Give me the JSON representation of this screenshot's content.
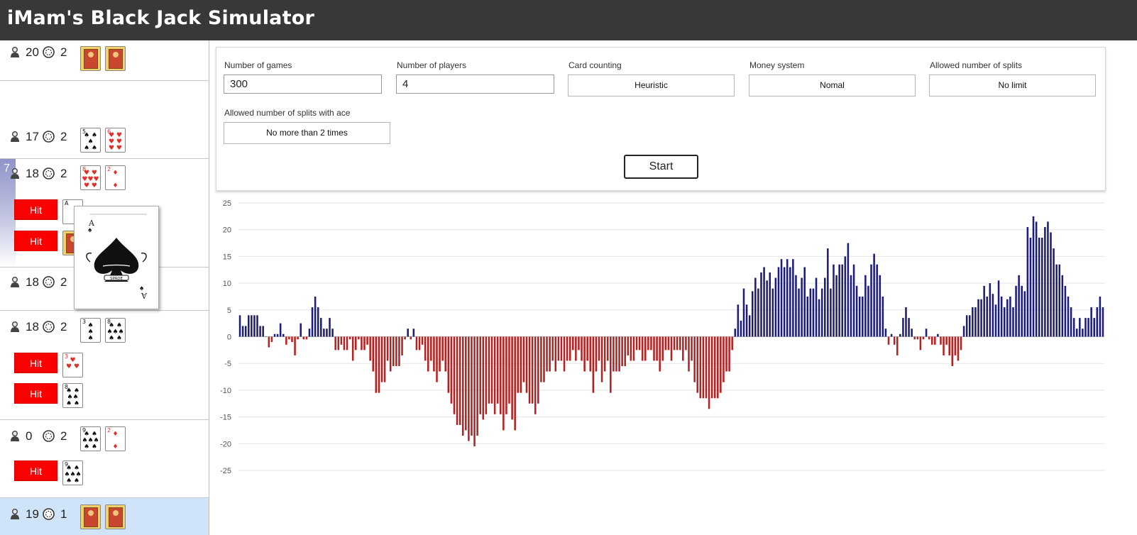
{
  "app": {
    "title": "iMam's Black Jack Simulator"
  },
  "sidebar": {
    "hit_label": "Hit",
    "active_badge": "7",
    "rows": [
      {
        "score": "20",
        "chips": "2"
      },
      {
        "score": "17",
        "chips": "2"
      },
      {
        "score": "18",
        "chips": "2"
      },
      {
        "score": "18",
        "chips": "2"
      },
      {
        "score": "18",
        "chips": "2"
      },
      {
        "score": "0",
        "chips": "2"
      },
      {
        "score": "19",
        "chips": "1"
      }
    ],
    "popup_card": {
      "rank": "A",
      "suit": "spades",
      "text": "SPADE"
    }
  },
  "settings": {
    "games": {
      "label": "Number of games",
      "value": "300"
    },
    "players": {
      "label": "Number of players",
      "value": "4"
    },
    "counting": {
      "label": "Card counting",
      "value": "Heuristic"
    },
    "money": {
      "label": "Money system",
      "value": "Nomal"
    },
    "splits": {
      "label": "Allowed number of splits",
      "value": "No limit"
    },
    "splits_ace": {
      "label": "Allowed number of splits with ace",
      "value": "No more than 2 times"
    },
    "start_label": "Start"
  },
  "chart_data": {
    "type": "bar",
    "ylim": [
      -25,
      25
    ],
    "yticks": [
      "25",
      "20",
      "15",
      "10",
      "5",
      "0",
      "-5",
      "-10",
      "-15",
      "-20",
      "-25"
    ],
    "grid": true,
    "positive_color": "#1c1c7c",
    "negative_color": "#b22222",
    "x": [
      1,
      2,
      3,
      4,
      5,
      6,
      7,
      8,
      9,
      10,
      11,
      12,
      13,
      14,
      15,
      16,
      17,
      18,
      19,
      20,
      21,
      22,
      23,
      24,
      25,
      26,
      27,
      28,
      29,
      30,
      31,
      32,
      33,
      34,
      35,
      36,
      37,
      38,
      39,
      40,
      41,
      42,
      43,
      44,
      45,
      46,
      47,
      48,
      49,
      50,
      51,
      52,
      53,
      54,
      55,
      56,
      57,
      58,
      59,
      60,
      61,
      62,
      63,
      64,
      65,
      66,
      67,
      68,
      69,
      70,
      71,
      72,
      73,
      74,
      75,
      76,
      77,
      78,
      79,
      80,
      81,
      82,
      83,
      84,
      85,
      86,
      87,
      88,
      89,
      90,
      91,
      92,
      93,
      94,
      95,
      96,
      97,
      98,
      99,
      100,
      101,
      102,
      103,
      104,
      105,
      106,
      107,
      108,
      109,
      110,
      111,
      112,
      113,
      114,
      115,
      116,
      117,
      118,
      119,
      120,
      121,
      122,
      123,
      124,
      125,
      126,
      127,
      128,
      129,
      130,
      131,
      132,
      133,
      134,
      135,
      136,
      137,
      138,
      139,
      140,
      141,
      142,
      143,
      144,
      145,
      146,
      147,
      148,
      149,
      150,
      151,
      152,
      153,
      154,
      155,
      156,
      157,
      158,
      159,
      160,
      161,
      162,
      163,
      164,
      165,
      166,
      167,
      168,
      169,
      170,
      171,
      172,
      173,
      174,
      175,
      176,
      177,
      178,
      179,
      180,
      181,
      182,
      183,
      184,
      185,
      186,
      187,
      188,
      189,
      190,
      191,
      192,
      193,
      194,
      195,
      196,
      197,
      198,
      199,
      200,
      201,
      202,
      203,
      204,
      205,
      206,
      207,
      208,
      209,
      210,
      211,
      212,
      213,
      214,
      215,
      216,
      217,
      218,
      219,
      220,
      221,
      222,
      223,
      224,
      225,
      226,
      227,
      228,
      229,
      230,
      231,
      232,
      233,
      234,
      235,
      236,
      237,
      238,
      239,
      240,
      241,
      242,
      243,
      244,
      245,
      246,
      247,
      248,
      249,
      250,
      251,
      252,
      253,
      254,
      255,
      256,
      257,
      258,
      259,
      260,
      261,
      262,
      263,
      264,
      265,
      266,
      267,
      268,
      269,
      270,
      271,
      272,
      273,
      274,
      275,
      276,
      277,
      278,
      279,
      280,
      281,
      282,
      283,
      284,
      285,
      286,
      287,
      288,
      289,
      290,
      291,
      292,
      293,
      294,
      295,
      296,
      297,
      298,
      299,
      300
    ],
    "values": [
      4,
      2,
      2,
      4,
      4,
      4,
      4,
      2,
      2,
      0,
      -2,
      -1,
      0.5,
      0.5,
      2.5,
      0.5,
      -1.5,
      -0.5,
      -1,
      -3.5,
      -0.5,
      2.5,
      -0.5,
      -0.5,
      1.5,
      5.5,
      7.5,
      5.5,
      3.5,
      1.5,
      1.5,
      3.5,
      1.5,
      -2.5,
      -2.5,
      -1.5,
      -2.5,
      -2.5,
      -0.5,
      -4.5,
      -2.5,
      -0.5,
      -2.5,
      -2.5,
      -1.5,
      -4.5,
      -6.5,
      -10.5,
      -10.5,
      -8.5,
      -8.5,
      -4.5,
      -6.5,
      -5.5,
      -5.5,
      -5.5,
      -3.5,
      -0.5,
      1.5,
      -0.5,
      1.5,
      -2.5,
      -2.5,
      -1.5,
      -4.5,
      -6.5,
      -4.5,
      -6.5,
      -8.5,
      -6.5,
      -4.5,
      -6.5,
      -10.5,
      -12.5,
      -14.5,
      -16.5,
      -16.5,
      -18.5,
      -17.5,
      -19.5,
      -18.5,
      -20.5,
      -18.5,
      -14.5,
      -15.5,
      -14.5,
      -12.5,
      -12.5,
      -14.5,
      -12.5,
      -14.5,
      -17.5,
      -14.5,
      -12.5,
      -15.5,
      -17.5,
      -10.5,
      -10.5,
      -8.5,
      -10.5,
      -12.5,
      -12.5,
      -14.5,
      -12.5,
      -8.5,
      -8.5,
      -6.5,
      -6.5,
      -4.5,
      -6.5,
      -4.5,
      -4.5,
      -6.5,
      -4.5,
      -4.5,
      -2.5,
      -4.5,
      -2.5,
      -4.5,
      -6.5,
      -4.5,
      -6.5,
      -10.5,
      -6.5,
      -4.5,
      -8.5,
      -6.5,
      -4.5,
      -10.5,
      -6.5,
      -6.5,
      -6.5,
      -5.5,
      -5.5,
      -3.5,
      -4.5,
      -4.5,
      -2.5,
      -2.5,
      -4.5,
      -4.5,
      -2.5,
      -2.5,
      -4.5,
      -4.5,
      -6.5,
      -4.5,
      -2.5,
      -2.5,
      -4.5,
      -2.5,
      -2.5,
      -2.5,
      -4.5,
      -2.5,
      -6.5,
      -4.5,
      -8.5,
      -10.5,
      -11.5,
      -11.5,
      -11.5,
      -13.5,
      -11.5,
      -11.5,
      -11.5,
      -10.5,
      -8.5,
      -6.5,
      -6.5,
      -2.5,
      1.5,
      6,
      3,
      9,
      6,
      4,
      8.5,
      11,
      9,
      12,
      13,
      10.5,
      12,
      9,
      11,
      13,
      14.5,
      13,
      14.5,
      13,
      14.5,
      11.5,
      9,
      11,
      13,
      7.5,
      9,
      9,
      11,
      7,
      9,
      11,
      16.5,
      9,
      13.5,
      11.5,
      13.5,
      13.5,
      15,
      17.5,
      11.5,
      13.5,
      9.5,
      7.5,
      7.5,
      11.5,
      9.5,
      13.5,
      15.5,
      13.5,
      11.5,
      7.5,
      1.5,
      -1.5,
      0.5,
      -1.5,
      -3.5,
      0.5,
      3.5,
      5.5,
      3.5,
      1.5,
      -0.5,
      -0.5,
      -2.5,
      -0.5,
      1.5,
      -0.5,
      -1.5,
      -1.5,
      0.5,
      -1.5,
      -3.5,
      -1.5,
      -3.5,
      -5.5,
      -3.5,
      -4.5,
      -2.5,
      2,
      4,
      4,
      5.5,
      5.5,
      7,
      7,
      9.5,
      7.5,
      10,
      8,
      6,
      10.5,
      7.5,
      5.5,
      7,
      7.5,
      5.5,
      9.5,
      11.5,
      9.5,
      8.5,
      20.5,
      18.5,
      22.5,
      21.5,
      18.5,
      18.5,
      20.5,
      21.5,
      19.5,
      16.5,
      13.5,
      13.5,
      11.5,
      9.5,
      7.5,
      5.5,
      3.5,
      1.5,
      3.5,
      1.5,
      3.5,
      3.5,
      5.5,
      3.5,
      5.5,
      7.5,
      5.5
    ]
  }
}
